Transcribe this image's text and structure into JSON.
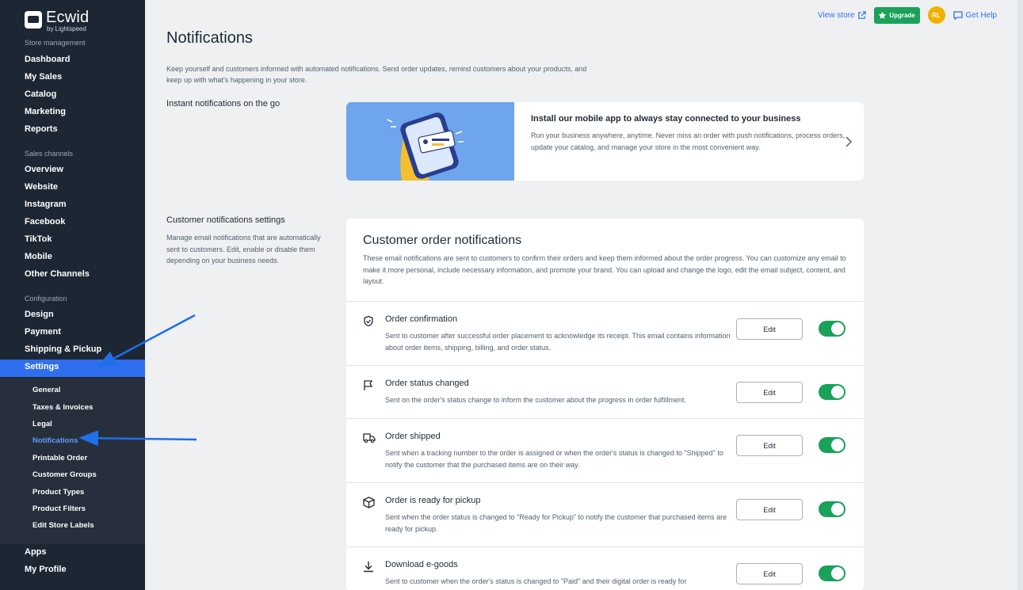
{
  "brand": {
    "name": "Ecwid",
    "sub": "by Lightspeed"
  },
  "sidebar": {
    "sections": [
      {
        "title": "Store management",
        "items": [
          "Dashboard",
          "My Sales",
          "Catalog",
          "Marketing",
          "Reports"
        ]
      },
      {
        "title": "Sales channels",
        "items": [
          "Overview",
          "Website",
          "Instagram",
          "Facebook",
          "TikTok",
          "Mobile",
          "Other Channels"
        ]
      },
      {
        "title": "Configuration",
        "items": [
          "Design",
          "Payment",
          "Shipping & Pickup"
        ]
      }
    ],
    "active_item": "Settings",
    "settings_sub": [
      "General",
      "Taxes & Invoices",
      "Legal",
      "Notifications",
      "Printable Order",
      "Customer Groups",
      "Product Types",
      "Product Filters",
      "Edit Store Labels"
    ],
    "active_sub": "Notifications",
    "bottom": [
      "Apps",
      "My Profile"
    ]
  },
  "header": {
    "view_store": "View store",
    "upgrade": "Upgrade",
    "avatar": "RL",
    "get_help": "Get Help"
  },
  "page": {
    "title": "Notifications",
    "description": "Keep yourself and customers informed with automated notifications. Send order updates, remind customers about your products, and keep up with what's happening in your store."
  },
  "instant": {
    "label": "Instant notifications on the go",
    "card_title": "Install our mobile app to always stay connected to your business",
    "card_desc": "Run your business anywhere, anytime. Never miss an order with push notifications, process orders, update your catalog, and manage your store in the most convenient way."
  },
  "customer_settings": {
    "label": "Customer notifications settings",
    "desc": "Manage email notifications that are automatically sent to customers. Edit, enable or disable them depending on your business needs."
  },
  "order_notifications": {
    "title": "Customer order notifications",
    "desc": "These email notifications are sent to customers to confirm their orders and keep them informed about the order progress. You can customize any email to make it more personal, include necessary information, and promote your brand. You can upload and change the logo, edit the email subject, content, and layout.",
    "edit_label": "Edit",
    "items": [
      {
        "title": "Order confirmation",
        "desc": "Sent to customer after successful order placement to acknowledge its receipt. This email contains information about order items, shipping, billing, and order status.",
        "icon": "shield-check-icon",
        "enabled": true
      },
      {
        "title": "Order status changed",
        "desc": "Sent on the order's status change to inform the customer about the progress in order fulfillment.",
        "icon": "flag-icon",
        "enabled": true
      },
      {
        "title": "Order shipped",
        "desc": "Sent when a tracking number to the order is assigned or when the order's status is changed to \"Shipped\" to notify the customer that the purchased items are on their way.",
        "icon": "truck-icon",
        "enabled": true
      },
      {
        "title": "Order is ready for pickup",
        "desc": "Sent when the order status is changed to \"Ready for Pickup\" to notify the customer that purchased items are ready for pickup.",
        "icon": "box-icon",
        "enabled": true
      },
      {
        "title": "Download e-goods",
        "desc": "Sent to customer when the order's status is changed to \"Paid\" and their digital order is ready for",
        "icon": "download-icon",
        "enabled": true
      }
    ]
  },
  "colors": {
    "sidebar": "#1d2734",
    "accent": "#2f6fef",
    "toggle_on": "#1aa15a",
    "avatar": "#f0b100"
  }
}
